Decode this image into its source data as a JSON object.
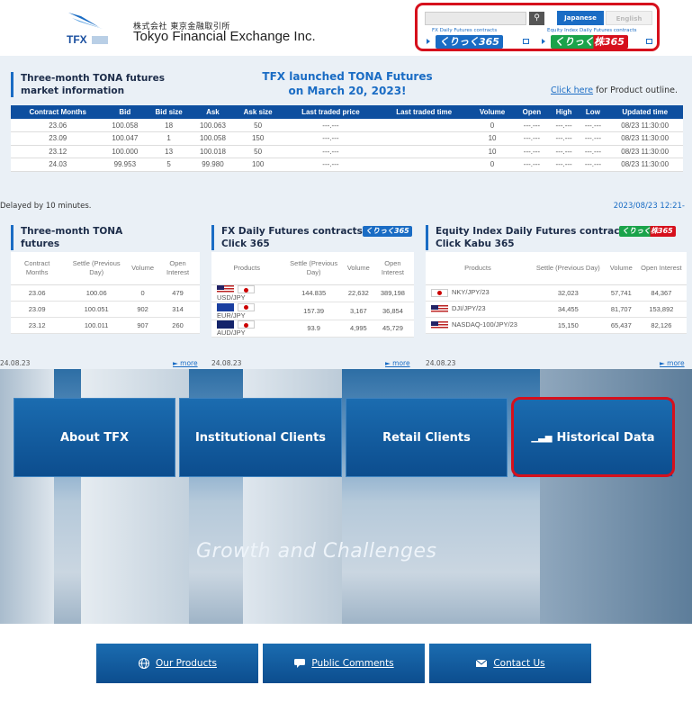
{
  "header": {
    "logo_text": "TFX",
    "company_jp": "株式会社 東京金融取引所",
    "company_en": "Tokyo Financial Exchange Inc.",
    "search_icon": "search-icon",
    "lang_japanese": "Japanese",
    "lang_english": "English",
    "click365_caption": "FX Daily Futures contracts",
    "click365_badge": "くりっく365",
    "kabu365_caption": "Equity Index Daily Futures contracts",
    "kabu365_badge": "くりっく株365"
  },
  "market": {
    "tona_title_line1": "Three-month TONA futures",
    "tona_title_line2": "market information",
    "announce_line1": "TFX launched TONA Futures",
    "announce_line2": "on March 20, 2023!",
    "outline_link": "Click here",
    "outline_rest": " for Product outline.",
    "columns": [
      "Contract Months",
      "Bid",
      "Bid size",
      "Ask",
      "Ask size",
      "Last traded price",
      "Last traded time",
      "Volume",
      "Open",
      "High",
      "Low",
      "Updated time"
    ],
    "rows": [
      [
        "23.06",
        "100.058",
        "18",
        "100.063",
        "50",
        "---.---",
        "",
        "0",
        "---.---",
        "---.---",
        "---.---",
        "08/23 11:30:00"
      ],
      [
        "23.09",
        "100.047",
        "1",
        "100.058",
        "150",
        "---.---",
        "",
        "10",
        "---.---",
        "---.---",
        "---.---",
        "08/23 11:30:00"
      ],
      [
        "23.12",
        "100.000",
        "13",
        "100.018",
        "50",
        "---.---",
        "",
        "10",
        "---.---",
        "---.---",
        "---.---",
        "08/23 11:30:00"
      ],
      [
        "24.03",
        "99.953",
        "5",
        "99.980",
        "100",
        "---.---",
        "",
        "0",
        "---.---",
        "---.---",
        "---.---",
        "08/23 11:30:00"
      ]
    ],
    "delayed": "Delayed by 10 minutes.",
    "timestamp": "2023/08/23 12:21-"
  },
  "tona_mini": {
    "title_line1": "Three-month TONA",
    "title_line2": "futures",
    "columns": [
      "Contract Months",
      "Settle (Previous Day)",
      "Volume",
      "Open Interest"
    ],
    "rows": [
      [
        "23.06",
        "100.06",
        "0",
        "479"
      ],
      [
        "23.09",
        "100.051",
        "902",
        "314"
      ],
      [
        "23.12",
        "100.011",
        "907",
        "260"
      ]
    ],
    "date": "24.08.23",
    "more": "► more"
  },
  "fx_mini": {
    "title_line1": "FX Daily Futures contracts",
    "title_line2": "Click 365",
    "badge": "くりっく365",
    "columns": [
      "Products",
      "Settle (Previous Day)",
      "Volume",
      "Open Interest"
    ],
    "rows": [
      [
        "USD/JPY",
        "144.835",
        "22,632",
        "389,198"
      ],
      [
        "EUR/JPY",
        "157.39",
        "3,167",
        "36,854"
      ],
      [
        "AUD/JPY",
        "93.9",
        "4,995",
        "45,729"
      ]
    ],
    "date": "24.08.23",
    "more": "► more"
  },
  "eq_mini": {
    "title_line1": "Equity Index Daily Futures contracts",
    "title_line2": "Click Kabu 365",
    "badge": "くりっく株365",
    "columns": [
      "Products",
      "Settle (Previous Day)",
      "Volume",
      "Open Interest"
    ],
    "rows": [
      [
        "NKY/JPY/23",
        "32,023",
        "57,741",
        "84,367"
      ],
      [
        "DJI/JPY/23",
        "34,455",
        "81,707",
        "153,892"
      ],
      [
        "NASDAQ-100/JPY/23",
        "15,150",
        "65,437",
        "82,126"
      ]
    ],
    "date": "24.08.23",
    "more": "► more"
  },
  "hero": {
    "nav": [
      "About TFX",
      "Institutional Clients",
      "Retail Clients",
      "Historical Data"
    ],
    "tagline": "Growth and Challenges"
  },
  "footer": {
    "links": [
      "Our Products",
      "Public Comments",
      "Contact Us"
    ]
  },
  "colors": {
    "brand_blue": "#0e4f9f",
    "accent_blue": "#1a6cc4",
    "highlight_red": "#d6101c",
    "click365_blue": "#1a6cc4",
    "kabu365_green": "#1aa34a"
  }
}
